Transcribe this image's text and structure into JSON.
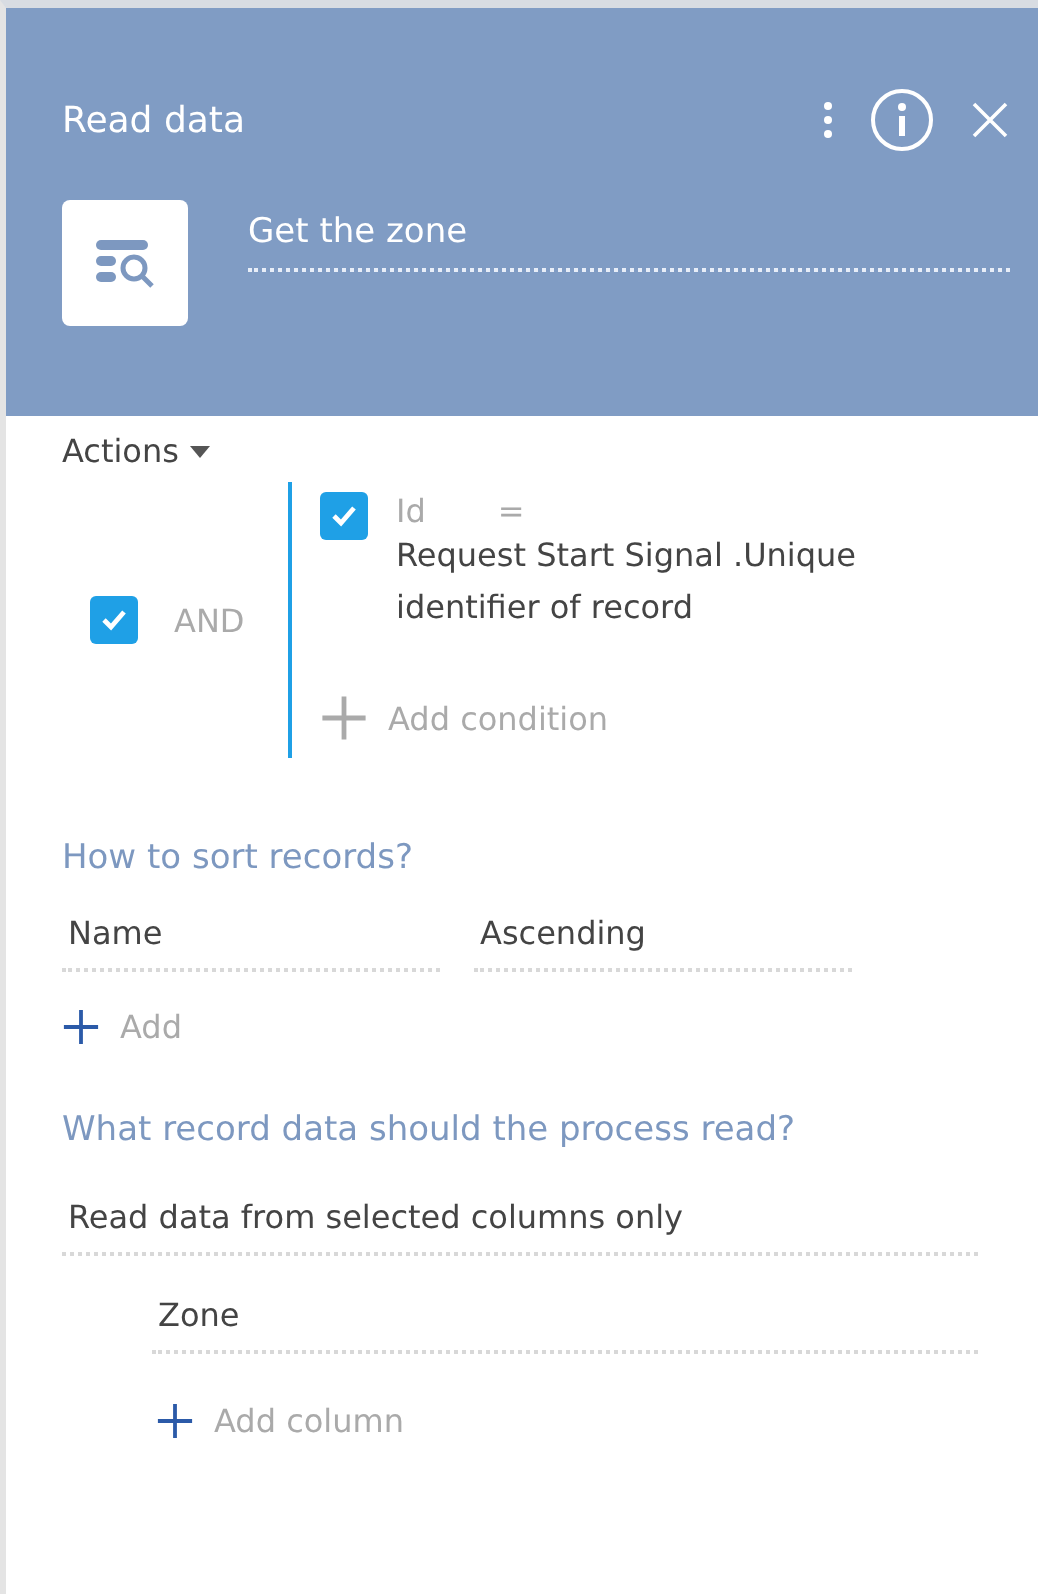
{
  "header": {
    "title": "Read data",
    "name_field": {
      "value": "Get the zone"
    }
  },
  "actions": {
    "label": "Actions"
  },
  "filter_group": {
    "operator": "AND",
    "checked": true,
    "conditions": [
      {
        "checked": true,
        "column": "Id",
        "comparison": "=",
        "value": "Request Start Signal .Unique identifier of record"
      }
    ],
    "add_label": "Add condition"
  },
  "sorting": {
    "heading": "How to sort records?",
    "column": "Name",
    "direction": "Ascending",
    "add_label": "Add"
  },
  "reading": {
    "heading": "What record data should the process read?",
    "mode": "Read data from selected columns only",
    "columns": [
      "Zone"
    ],
    "add_label": "Add column"
  }
}
